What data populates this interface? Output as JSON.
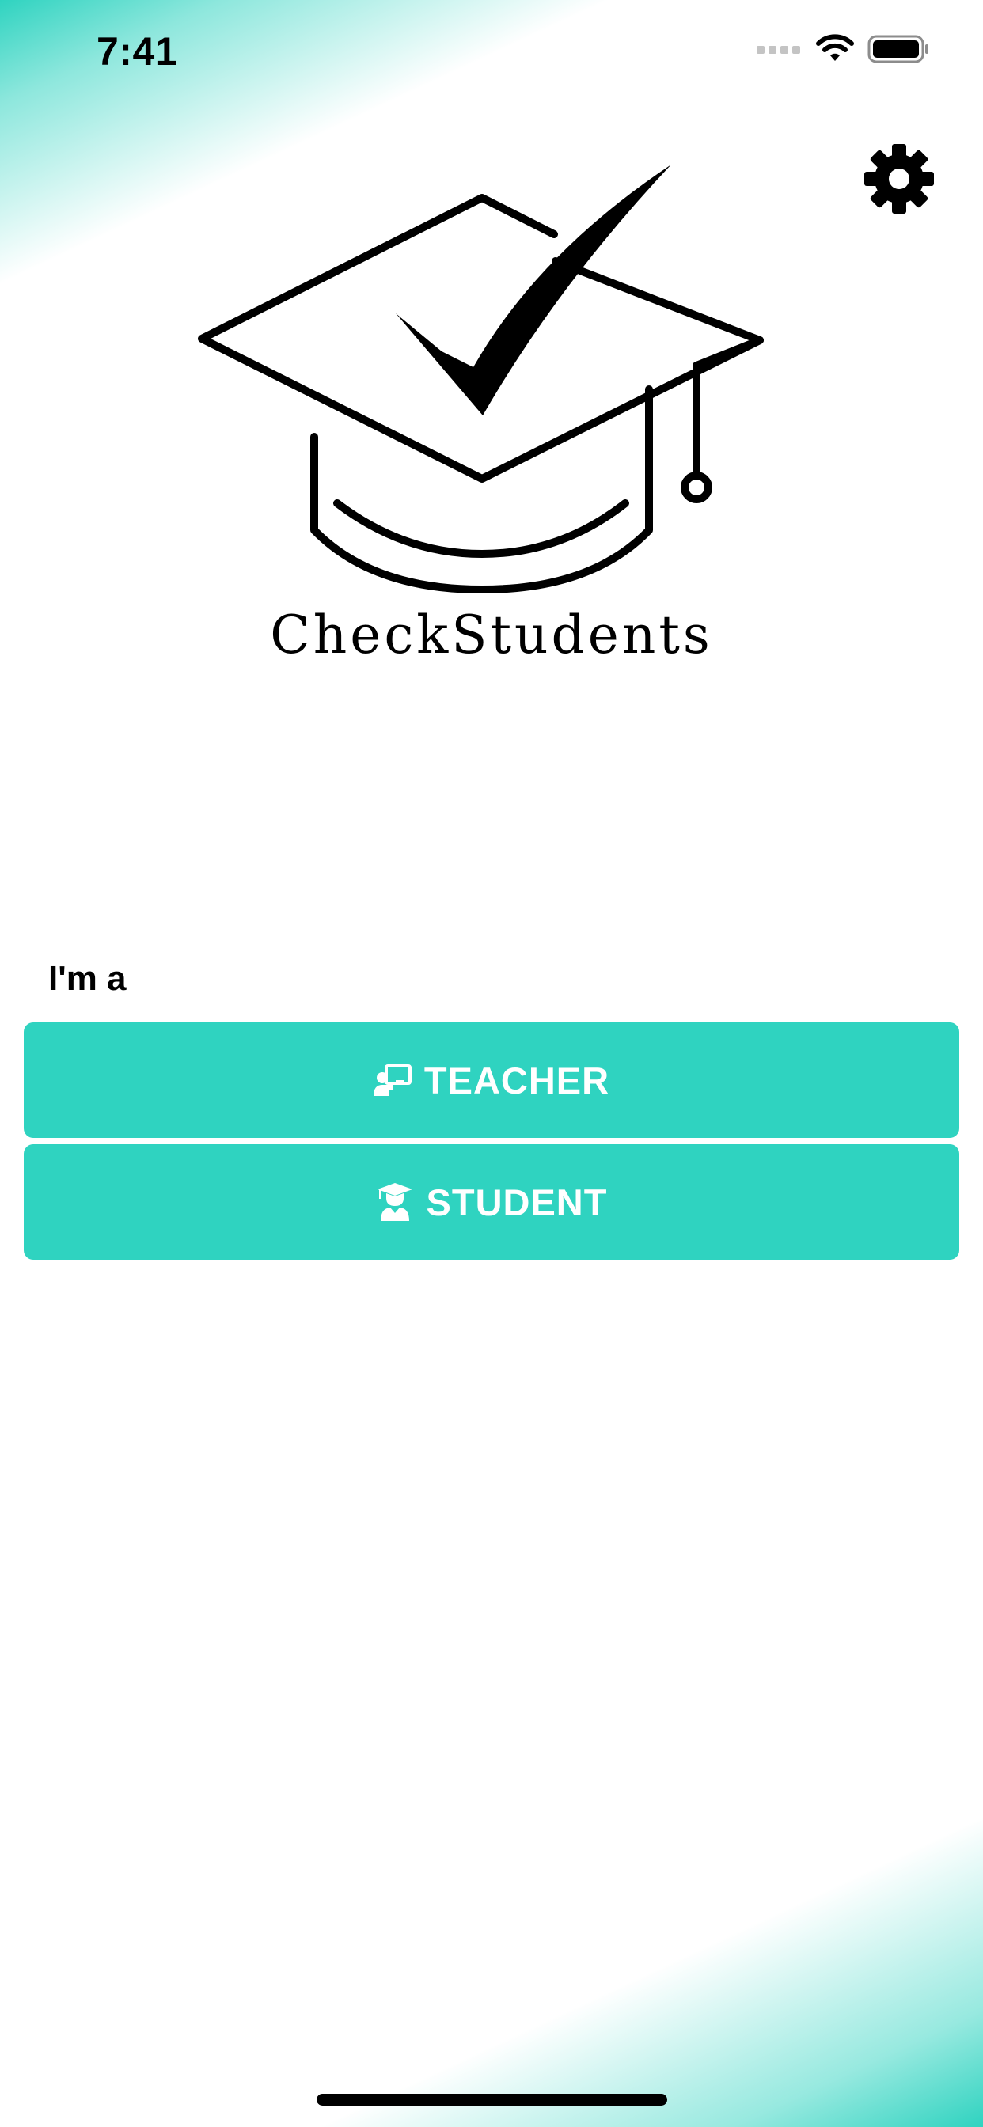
{
  "status_bar": {
    "time": "7:41"
  },
  "header": {
    "settings_icon": "gear-icon"
  },
  "brand": {
    "logo_icon": "graduation-cap-checkmark-logo",
    "name": "CheckStudents"
  },
  "role_selection": {
    "label": "I'm a",
    "buttons": [
      {
        "label": "TEACHER",
        "icon": "teacher-presentation-icon"
      },
      {
        "label": "STUDENT",
        "icon": "student-graduate-icon"
      }
    ]
  },
  "colors": {
    "accent": "#2fd3c0",
    "text": "#000000",
    "button_text": "#ffffff"
  }
}
